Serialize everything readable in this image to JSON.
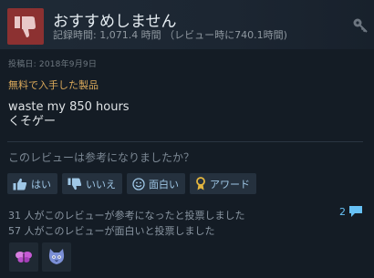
{
  "review": {
    "verdict": "おすすめしません",
    "playtime": "記録時間: 1,071.4 時間 （レビュー時に740.1時間)",
    "posted": "投稿日: 2018年9月9日",
    "free_label": "無料で入手した製品",
    "body_line1": "waste my 850 hours",
    "body_line2": "くそゲー",
    "helpful_question": "このレビューは参考になりましたか？",
    "buttons": {
      "yes": "はい",
      "no": "いいえ",
      "funny": "面白い",
      "award": "アワード"
    },
    "helpful_stat": "31 人がこのレビューが参考になったと投票しました",
    "funny_stat": "57 人がこのレビューが面白いと投票しました",
    "comment_count": "2"
  },
  "colors": {
    "not_recommended_bg": "#8c3131",
    "link_blue": "#67c1f5",
    "free_gold": "#d9a85a",
    "background": "#141c25"
  },
  "icons": {
    "verdict": "thumbs-down-icon",
    "product": "key-icon",
    "yes": "thumbs-up-icon",
    "no": "thumbs-down-icon",
    "funny": "smile-icon",
    "award": "award-ribbon-icon",
    "comment": "comment-bubble-icon",
    "award_badge_1": "pink-butterfly-award-icon",
    "award_badge_2": "cat-face-award-icon"
  }
}
